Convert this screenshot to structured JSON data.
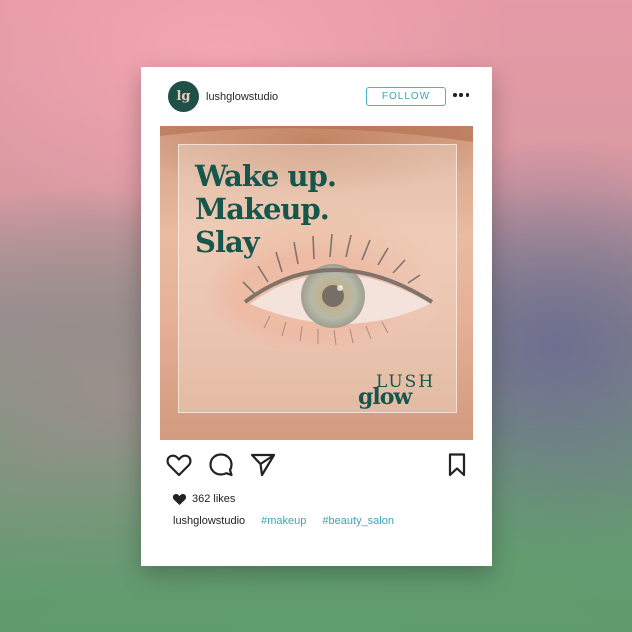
{
  "post": {
    "username": "lushglowstudio",
    "avatar_mark": "lg",
    "follow_label": "FOLLOW",
    "image": {
      "headline": [
        "Wake up.",
        "Makeup.",
        "Slay"
      ],
      "brand_top": "LUSH",
      "brand_bottom": "glow"
    },
    "likes": "362 likes",
    "caption": {
      "username": "lushglowstudio",
      "hashtags": [
        "#makeup",
        "#beauty_salon"
      ]
    }
  },
  "icons": {
    "more": "more-options-icon",
    "like": "heart-icon",
    "comment": "comment-icon",
    "share": "send-icon",
    "save": "bookmark-icon",
    "likes": "heart-filled-icon"
  },
  "colors": {
    "brand_green": "#15574c",
    "accent_teal": "#3ba6b3",
    "card": "#ffffff"
  }
}
